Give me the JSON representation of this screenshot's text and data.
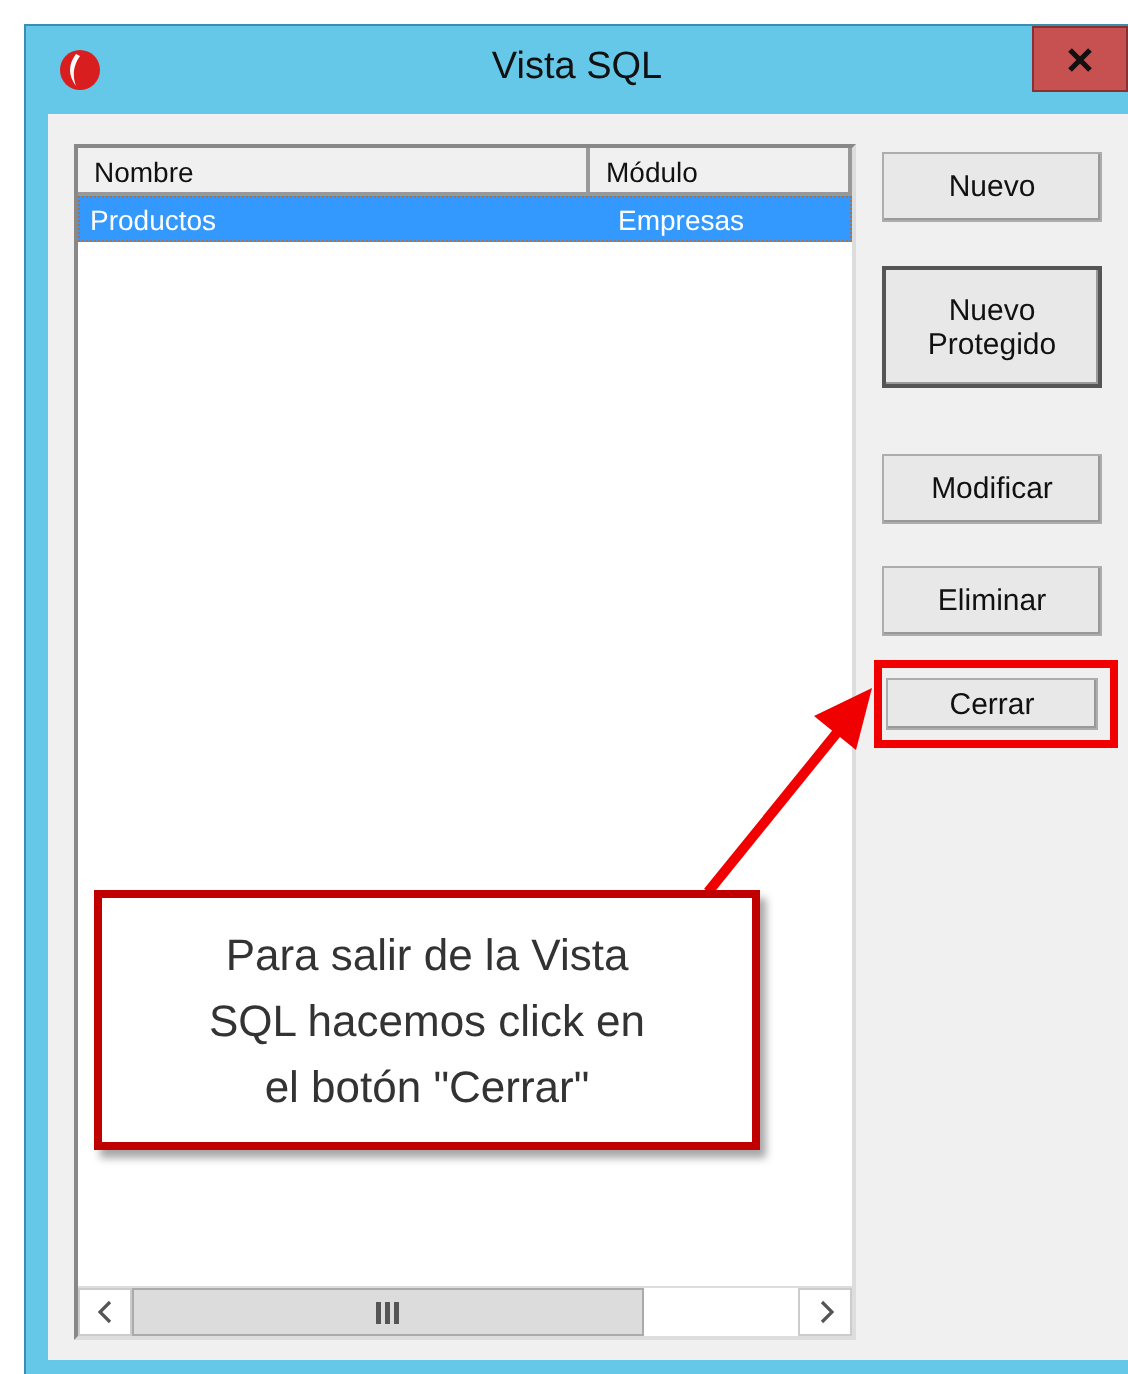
{
  "window": {
    "title": "Vista SQL"
  },
  "table": {
    "columns": [
      "Nombre",
      "Módulo"
    ],
    "rows": [
      {
        "cells": [
          "Productos",
          "Empresas"
        ],
        "selected": true
      }
    ]
  },
  "buttons": [
    {
      "label": "Nuevo",
      "default": false,
      "highlighted": false
    },
    {
      "label": "Nuevo Protegido",
      "default": true,
      "highlighted": false
    },
    {
      "label": "Modificar",
      "default": false,
      "highlighted": false
    },
    {
      "label": "Eliminar",
      "default": false,
      "highlighted": false
    },
    {
      "label": "Cerrar",
      "default": false,
      "highlighted": true
    }
  ],
  "annotation": {
    "text": "Para salir de la Vista SQL hacemos click en el botón \"Cerrar\""
  }
}
